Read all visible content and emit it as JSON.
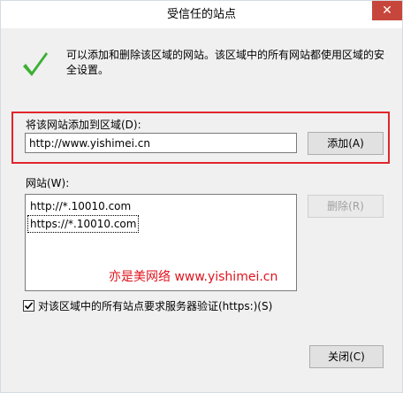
{
  "window": {
    "title": "受信任的站点",
    "close_glyph": "✕"
  },
  "info": {
    "text": "可以添加和删除该区域的网站。该区域中的所有网站都使用区域的安全设置。",
    "icon": "check-icon"
  },
  "add_section": {
    "label": "将该网站添加到区域(D):",
    "input_value": "http://www.yishimei.cn",
    "add_button_label": "添加(A)"
  },
  "sites": {
    "label": "网站(W):",
    "items": [
      "http://*.10010.com",
      "https://*.10010.com"
    ],
    "remove_button_label": "删除(R)"
  },
  "watermark": {
    "text": "亦是美网络 www.yishimei.cn"
  },
  "https_check": {
    "label": "对该区域中的所有站点要求服务器验证(https:)(S)",
    "checked": true
  },
  "footer": {
    "close_button_label": "关闭(C)"
  },
  "colors": {
    "highlight_border": "#e0252b",
    "close_button_bg": "#c7463b",
    "check_icon": "#3cb033",
    "watermark_text": "#e0121c"
  }
}
